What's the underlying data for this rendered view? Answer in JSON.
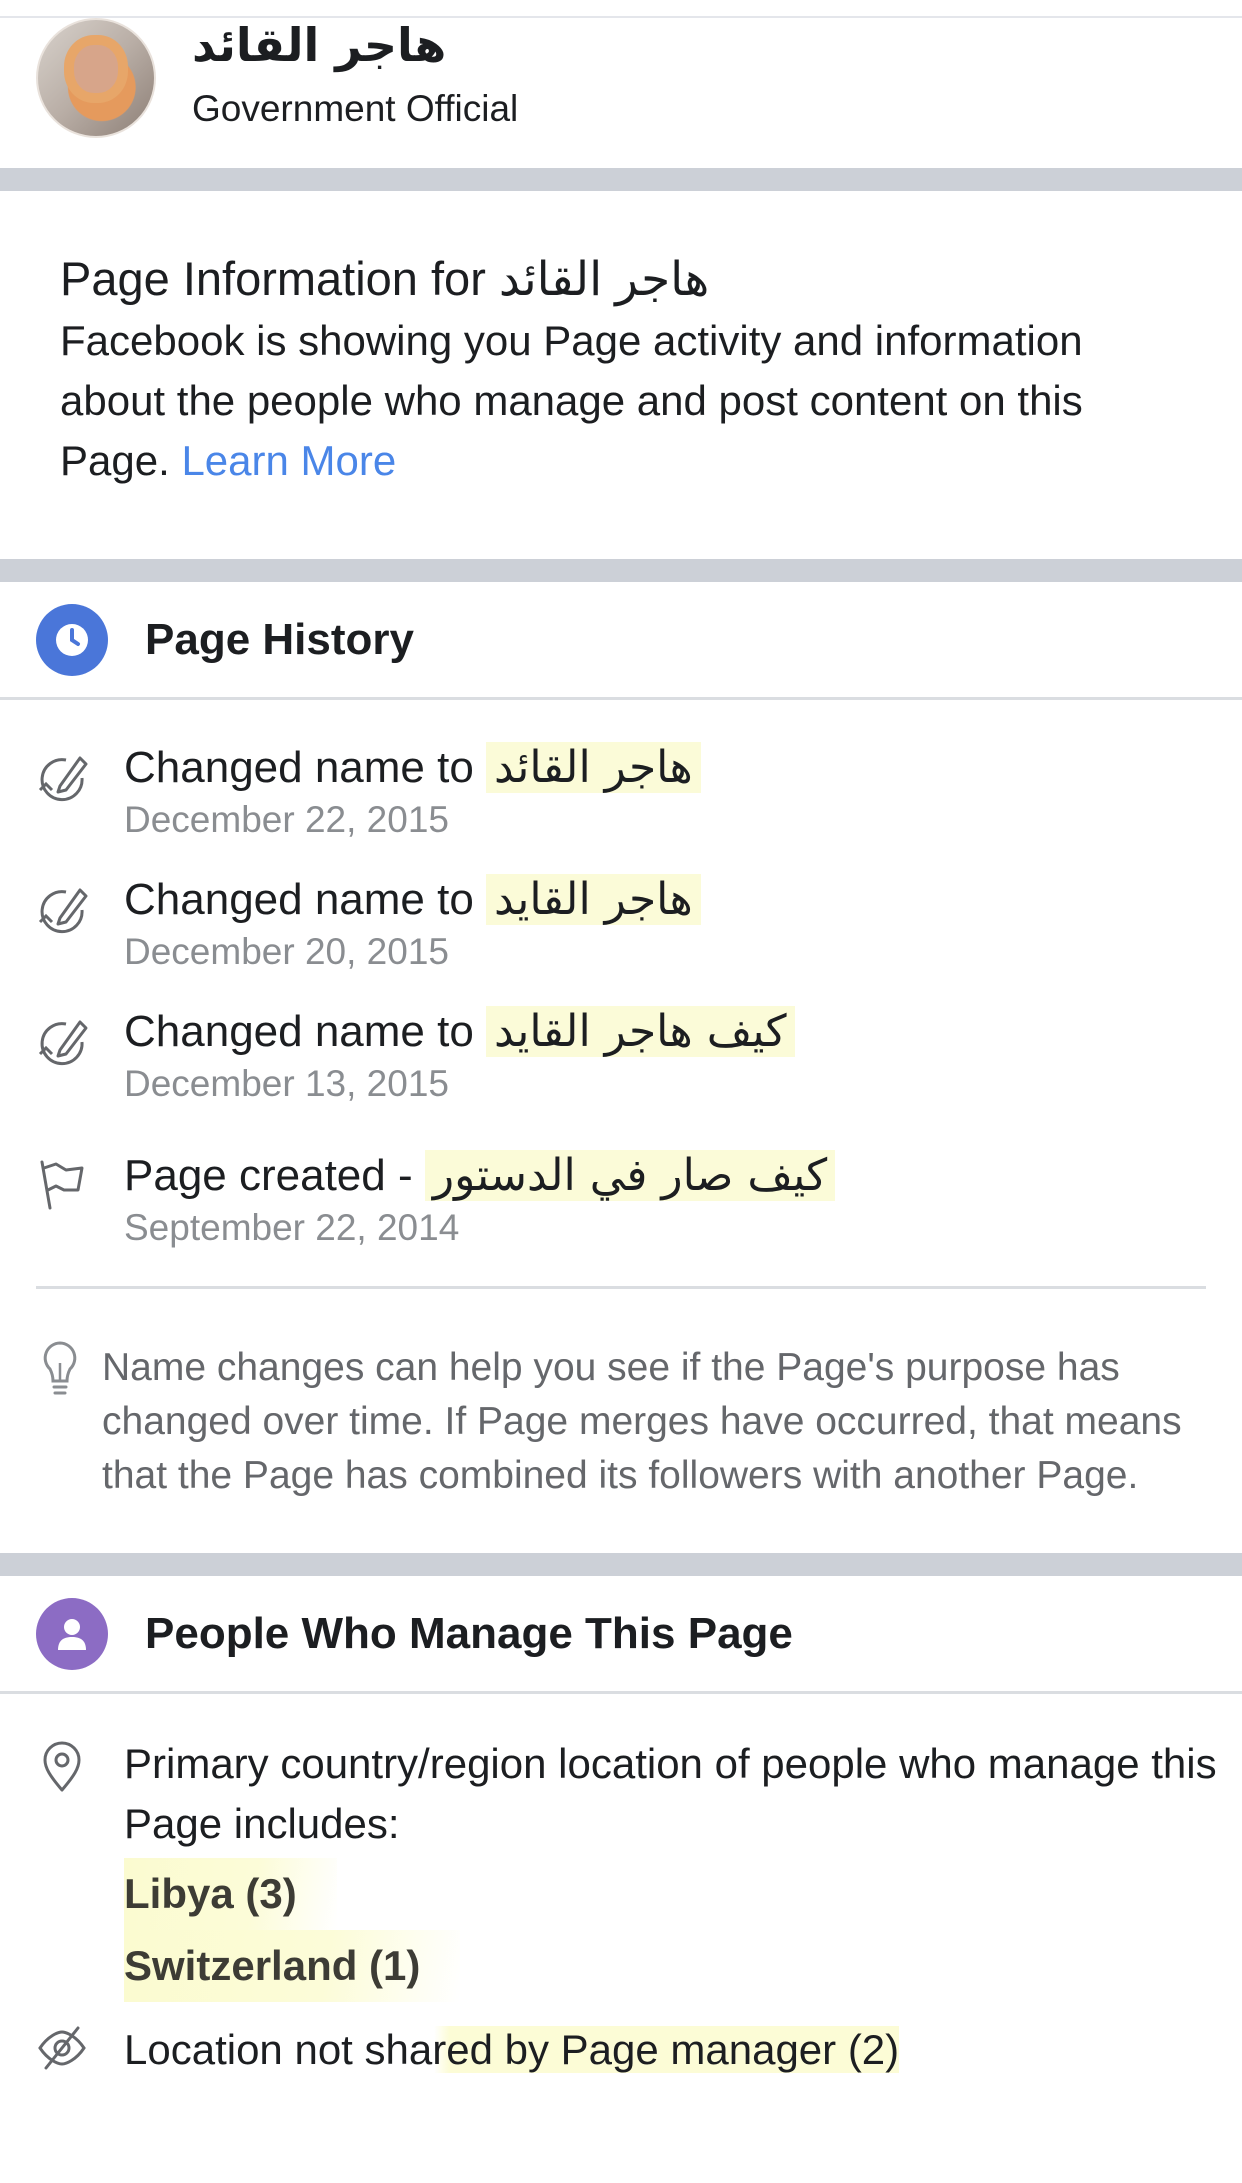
{
  "header": {
    "page_name": "هاجر القائد",
    "category": "Government Official"
  },
  "info": {
    "title": "Page Information for هاجر القائد",
    "body": "Facebook is showing you Page activity and information about the people who manage and post content on this Page. ",
    "learn_more": "Learn More"
  },
  "history": {
    "heading": "Page History",
    "items": [
      {
        "prefix": "Changed name to ",
        "name": "هاجر القائد",
        "date": "December 22, 2015",
        "icon": "edit-icon"
      },
      {
        "prefix": "Changed name to ",
        "name": "هاجر القايد",
        "date": "December 20, 2015",
        "icon": "edit-icon"
      },
      {
        "prefix": "Changed name to ",
        "name": "كيف هاجر القايد",
        "date": "December 13, 2015",
        "icon": "edit-icon"
      },
      {
        "prefix": "Page created - ",
        "name": "كيف صار في الدستور",
        "date": "September 22, 2014",
        "icon": "flag-icon"
      }
    ],
    "tip": "Name changes can help you see if the Page's purpose has changed over time. If Page merges have occurred, that means that the Page has combined its followers with another Page."
  },
  "managers": {
    "heading": "People Who Manage This Page",
    "location_text": "Primary country/region location of people who manage this Page includes:",
    "countries": [
      "Libya (3)",
      "Switzerland (1)"
    ],
    "not_shared": "Location not shared by Page manager (2)"
  },
  "colors": {
    "history_icon": "#4a76d9",
    "managers_icon": "#8c6cc4",
    "link": "#4a86e8",
    "separator": "#ccd0d7",
    "highlight": "#fbfbd8"
  }
}
